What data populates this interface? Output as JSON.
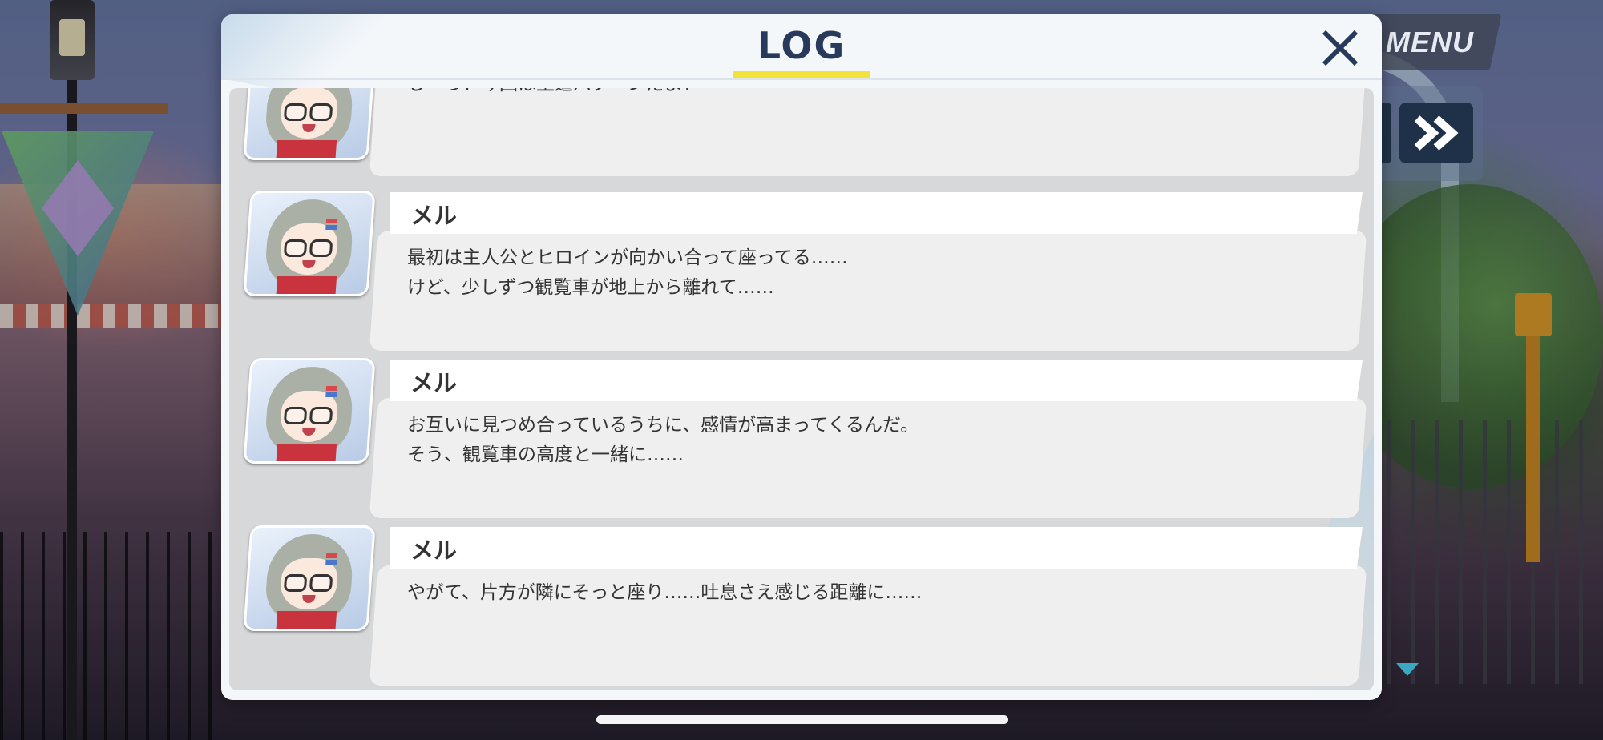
{
  "header": {
    "title": "LOG"
  },
  "hud": {
    "menu_label": "MENU"
  },
  "entries": [
    {
      "name": "",
      "lines": [
        "しーっ！今回は王道パターンだよ！"
      ]
    },
    {
      "name": "メル",
      "lines": [
        "最初は主人公とヒロインが向かい合って座ってる……",
        "けど、少しずつ観覧車が地上から離れて……"
      ]
    },
    {
      "name": "メル",
      "lines": [
        "お互いに見つめ合っているうちに、感情が高まってくるんだ。",
        "そう、観覧車の高度と一緒に……"
      ]
    },
    {
      "name": "メル",
      "lines": [
        "やがて、片方が隣にそっと座り……吐息さえ感じる距離に……"
      ]
    }
  ],
  "icons": {
    "close": "close-icon",
    "fast_forward": "fast-forward-icon",
    "scroll_down": "triangle-down-icon",
    "avatar": "character-portrait"
  },
  "colors": {
    "title": "#273a5c",
    "underline": "#f2e33a",
    "accent_button": "#1f3148",
    "scroll_arrow": "#3aa7c7"
  }
}
